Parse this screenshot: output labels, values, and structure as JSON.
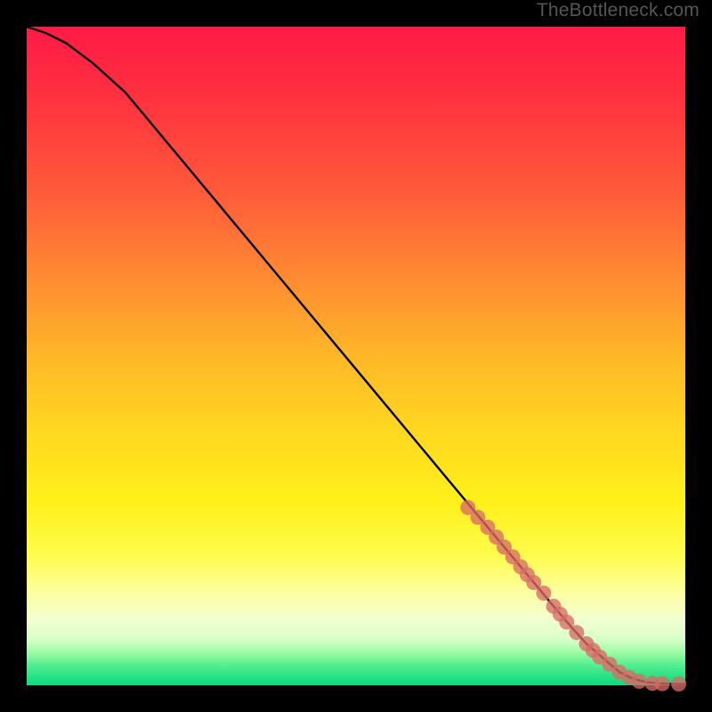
{
  "watermark": "TheBottleneck.com",
  "chart_data": {
    "type": "line",
    "title": "",
    "xlabel": "",
    "ylabel": "",
    "xlim": [
      0,
      100
    ],
    "ylim": [
      0,
      100
    ],
    "series": [
      {
        "name": "curve",
        "x": [
          0,
          3,
          6,
          10,
          15,
          20,
          30,
          40,
          50,
          60,
          70,
          75,
          80,
          83,
          85,
          88,
          90,
          92,
          94,
          96,
          98,
          100
        ],
        "y": [
          100,
          99,
          97.5,
          94.5,
          90,
          84,
          72,
          60,
          48,
          36,
          24,
          18,
          12,
          8.5,
          6.3,
          3.7,
          2.0,
          1.0,
          0.5,
          0.3,
          0.2,
          0.2
        ]
      }
    ],
    "scatter": {
      "name": "highlighted-points",
      "color": "#d86a66",
      "x": [
        67,
        68.5,
        70,
        71.3,
        72.5,
        73.8,
        75,
        76,
        77,
        78.5,
        80,
        81,
        82,
        83.5,
        85,
        86,
        87,
        88.5,
        90,
        91.5,
        93,
        95,
        96.5,
        99
      ],
      "y": [
        27,
        25.5,
        24,
        22.5,
        21,
        19.5,
        18,
        16.8,
        15.6,
        14,
        12,
        10.8,
        9.6,
        8,
        6.3,
        5.3,
        4.3,
        3.2,
        2.0,
        1.2,
        0.6,
        0.3,
        0.25,
        0.2
      ]
    },
    "background_gradient": {
      "direction": "vertical",
      "stops": [
        {
          "pos": 0.0,
          "color": "#ff1a46"
        },
        {
          "pos": 0.5,
          "color": "#ffb728"
        },
        {
          "pos": 0.8,
          "color": "#fffb4a"
        },
        {
          "pos": 0.95,
          "color": "#9efba6"
        },
        {
          "pos": 1.0,
          "color": "#14d97f"
        }
      ]
    }
  }
}
